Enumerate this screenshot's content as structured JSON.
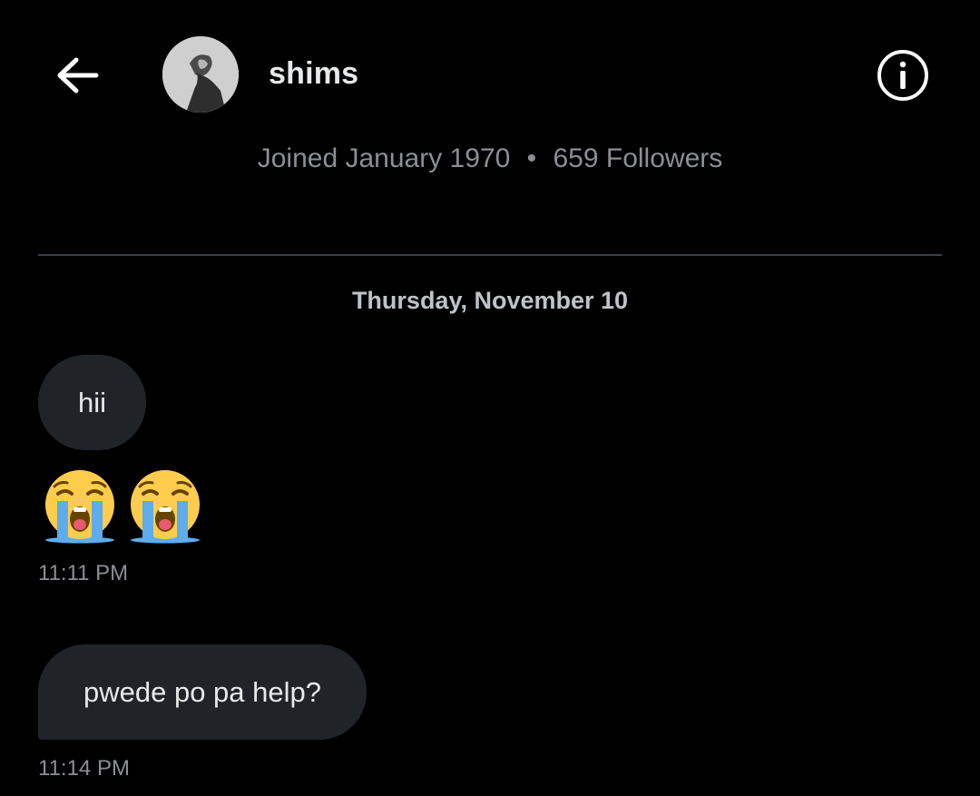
{
  "header": {
    "back_icon": "arrow-left-icon",
    "username": "shims",
    "info_icon": "info-circle-icon",
    "joined": "Joined January 1970",
    "separator": "•",
    "followers": "659 Followers"
  },
  "conversation": {
    "date_separator": "Thursday, November 10",
    "messages": [
      {
        "text": "hii",
        "emojis": [
          "loudly-crying-face-icon",
          "loudly-crying-face-icon"
        ],
        "time": "11:11 PM"
      },
      {
        "text": "pwede po pa help?",
        "time": "11:14 PM"
      }
    ]
  },
  "colors": {
    "background": "#000000",
    "bubble": "#202428",
    "primary_text": "#e7e9ea",
    "secondary_text": "#8b8f94",
    "divider": "#3a3e42"
  }
}
